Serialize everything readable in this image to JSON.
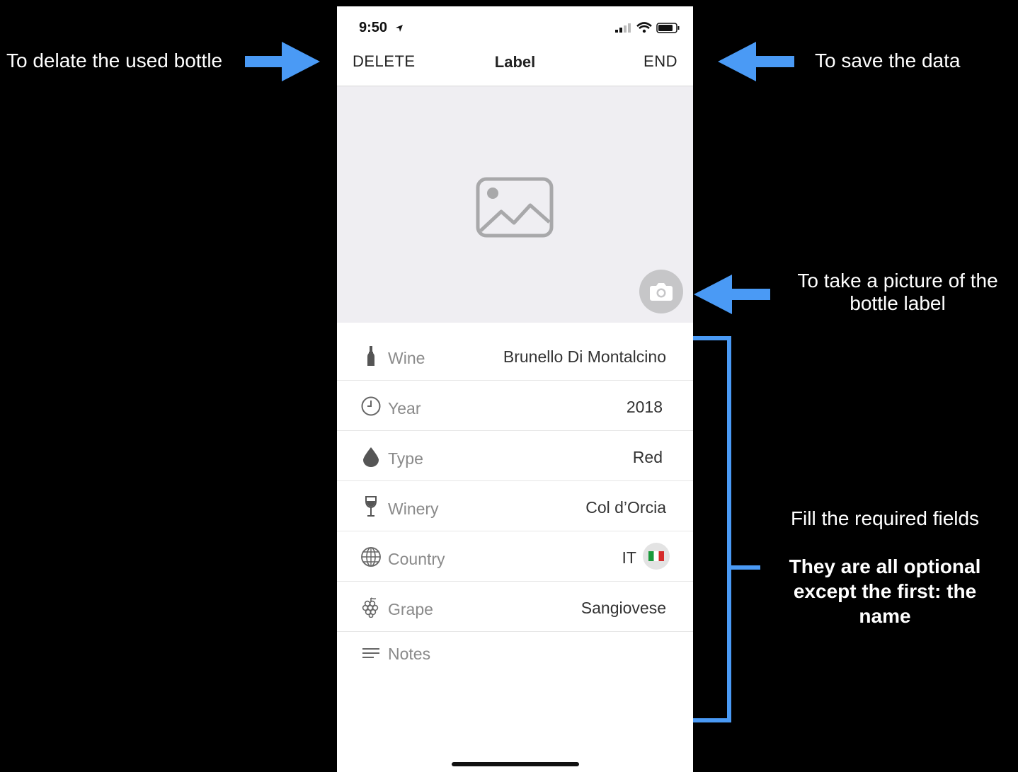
{
  "status_bar": {
    "time": "9:50"
  },
  "nav": {
    "left_label": "DELETE",
    "title": "Label",
    "right_label": "END"
  },
  "fields": [
    {
      "icon": "bottle-icon",
      "label": "Wine",
      "value": "Brunello Di Montalcino"
    },
    {
      "icon": "clock-icon",
      "label": "Year",
      "value": "2018"
    },
    {
      "icon": "drop-icon",
      "label": "Type",
      "value": "Red"
    },
    {
      "icon": "wine-glass-icon",
      "label": "Winery",
      "value": "Col d’Orcia"
    },
    {
      "icon": "globe-icon",
      "label": "Country",
      "value": "IT"
    },
    {
      "icon": "grapes-icon",
      "label": "Grape",
      "value": "Sangiovese"
    },
    {
      "icon": "notes-icon",
      "label": "Notes",
      "value": ""
    }
  ],
  "annotations": {
    "delete": "To delate the used bottle",
    "save": "To save the data",
    "camera": "To take a picture of the bottle label",
    "fill": "Fill the required fields",
    "optional": "They are all optional except the first: the name"
  },
  "colors": {
    "annotation_arrow": "#4a9af5",
    "photo_bg": "#efeef2"
  }
}
